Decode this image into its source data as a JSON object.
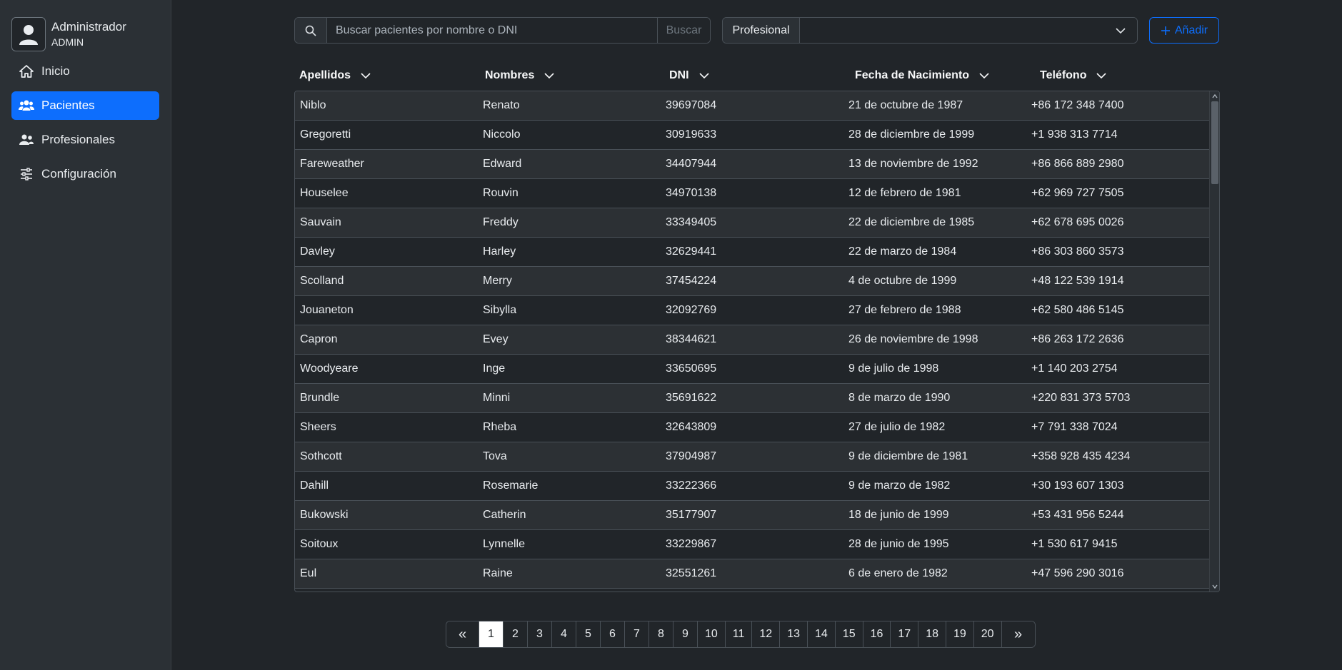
{
  "user": {
    "name": "Administrador",
    "role": "ADMIN"
  },
  "nav": [
    {
      "label": "Inicio",
      "icon": "home-icon",
      "active": false
    },
    {
      "label": "Pacientes",
      "icon": "patients-icon",
      "active": true
    },
    {
      "label": "Profesionales",
      "icon": "professionals-icon",
      "active": false
    },
    {
      "label": "Configuración",
      "icon": "sliders-icon",
      "active": false
    }
  ],
  "search": {
    "placeholder": "Buscar pacientes por nombre o DNI",
    "value": "",
    "button_label": "Buscar"
  },
  "filter": {
    "label": "Profesional",
    "selected": ""
  },
  "add_button": {
    "label": "Añadir"
  },
  "table": {
    "columns": [
      "Apellidos",
      "Nombres",
      "DNI",
      "Fecha de Nacimiento",
      "Teléfono"
    ],
    "rows": [
      [
        "Niblo",
        "Renato",
        "39697084",
        "21 de octubre de 1987",
        "+86 172 348 7400"
      ],
      [
        "Gregoretti",
        "Niccolo",
        "30919633",
        "28 de diciembre de 1999",
        "+1 938 313 7714"
      ],
      [
        "Fareweather",
        "Edward",
        "34407944",
        "13 de noviembre de 1992",
        "+86 866 889 2980"
      ],
      [
        "Houselee",
        "Rouvin",
        "34970138",
        "12 de febrero de 1981",
        "+62 969 727 7505"
      ],
      [
        "Sauvain",
        "Freddy",
        "33349405",
        "22 de diciembre de 1985",
        "+62 678 695 0026"
      ],
      [
        "Davley",
        "Harley",
        "32629441",
        "22 de marzo de 1984",
        "+86 303 860 3573"
      ],
      [
        "Scolland",
        "Merry",
        "37454224",
        "4 de octubre de 1999",
        "+48 122 539 1914"
      ],
      [
        "Jouaneton",
        "Sibylla",
        "32092769",
        "27 de febrero de 1988",
        "+62 580 486 5145"
      ],
      [
        "Capron",
        "Evey",
        "38344621",
        "26 de noviembre de 1998",
        "+86 263 172 2636"
      ],
      [
        "Woodyeare",
        "Inge",
        "33650695",
        "9 de julio de 1998",
        "+1 140 203 2754"
      ],
      [
        "Brundle",
        "Minni",
        "35691622",
        "8 de marzo de 1990",
        "+220 831 373 5703"
      ],
      [
        "Sheers",
        "Rheba",
        "32643809",
        "27 de julio de 1982",
        "+7 791 338 7024"
      ],
      [
        "Sothcott",
        "Tova",
        "37904987",
        "9 de diciembre de 1981",
        "+358 928 435 4234"
      ],
      [
        "Dahill",
        "Rosemarie",
        "33222366",
        "9 de marzo de 1982",
        "+30 193 607 1303"
      ],
      [
        "Bukowski",
        "Catherin",
        "35177907",
        "18 de junio de 1999",
        "+53 431 956 5244"
      ],
      [
        "Soitoux",
        "Lynnelle",
        "33229867",
        "28 de junio de 1995",
        "+1 530 617 9415"
      ],
      [
        "Eul",
        "Raine",
        "32551261",
        "6 de enero de 1982",
        "+47 596 290 3016"
      ]
    ]
  },
  "pagination": {
    "prev": "«",
    "next": "»",
    "pages": [
      "1",
      "2",
      "3",
      "4",
      "5",
      "6",
      "7",
      "8",
      "9",
      "10",
      "11",
      "12",
      "13",
      "14",
      "15",
      "16",
      "17",
      "18",
      "19",
      "20"
    ],
    "current": "1"
  },
  "colors": {
    "accent": "#0d6efd",
    "background": "#212529",
    "sidebar": "#2b3035",
    "row_alt": "#2c3034"
  }
}
